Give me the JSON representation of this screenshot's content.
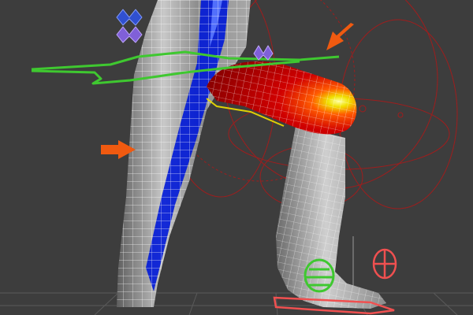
{
  "viewport": {
    "background": "#3d3d3d",
    "colors": {
      "weight_high": "#d40000",
      "weight_mid": "#f0e000",
      "weight_low": "#0018d8",
      "mesh_base": "#bcbcbc",
      "wireframe": "#ffffff",
      "envelope": "#b01818",
      "selection_control": "#3fc830",
      "foot_control": "#f05050",
      "bone_handle_blue": "#3050d0",
      "bone_handle_purple": "#8060d8",
      "callout_arrow": "#f05a10"
    },
    "icons": [
      "callout-arrow-icon",
      "bone-handle-icon",
      "gimbal-control-icon",
      "foot-pad-icon"
    ]
  }
}
